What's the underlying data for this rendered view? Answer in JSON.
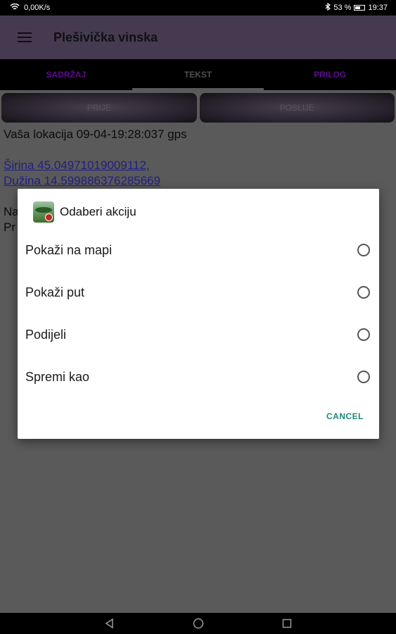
{
  "statusbar": {
    "speed": "0,00K/s",
    "battery": "53 %",
    "time": "19:37"
  },
  "appbar": {
    "title": "Plešivička vinska"
  },
  "tabs": [
    {
      "label": "SADRŽAJ"
    },
    {
      "label": "TEKST"
    },
    {
      "label": "PRILOG"
    }
  ],
  "buttons": {
    "prev": "PRIJE",
    "next": "POSLIJE"
  },
  "content": {
    "location": "Vaša lokacija 09-04-19:28:037 gps",
    "latitude": "Širina 45.04971019009112,",
    "longitude": " Dužina 14.599886376285669",
    "line_na": "Na",
    "line_pr": "Pr"
  },
  "dialog": {
    "title": "Odaberi akciju",
    "options": [
      {
        "label": "Pokaži na mapi"
      },
      {
        "label": "Pokaži put"
      },
      {
        "label": "Podijeli"
      },
      {
        "label": "Spremi kao"
      }
    ],
    "cancel": "CANCEL"
  }
}
